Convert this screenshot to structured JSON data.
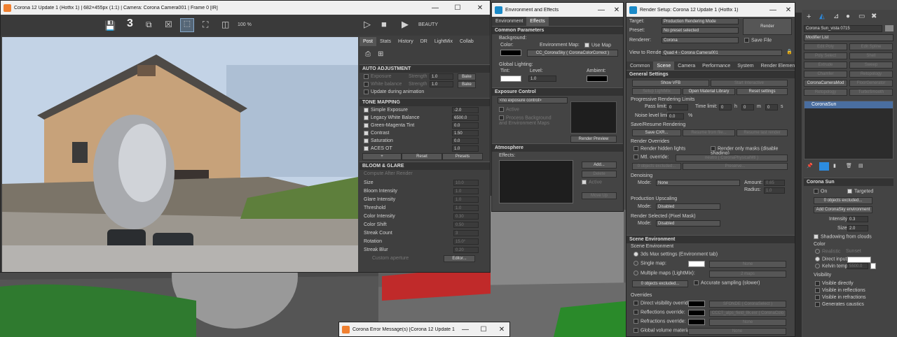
{
  "colors": {
    "accent": "#2c8ce0",
    "viewport_bg": "#3d3d3d",
    "panel": "#444444"
  },
  "vfb": {
    "title": "Corona 12 Update 1 (Hotfix 1) | 682×455px (1:1) | Camera: Corona Camera001 | Frame 0 [IR]",
    "zoom": "100 %",
    "channel": "BEAUTY",
    "tabs": [
      "Post",
      "Stats",
      "History",
      "DR",
      "LightMix",
      "Collab"
    ],
    "auto_adjust": {
      "header": "AUTO ADJUSTMENT",
      "exposure": "Exposure",
      "strength": "Strength",
      "wb": "White balance",
      "val": "1.0",
      "bake": "Bake",
      "update": "Update during animation"
    },
    "tone": {
      "header": "TONE MAPPING",
      "rows": [
        {
          "label": "Simple Exposure",
          "value": "-2.0"
        },
        {
          "label": "Legacy White Balance",
          "value": "6500.0"
        },
        {
          "label": "Green-Magenta Tint",
          "value": "0.0"
        },
        {
          "label": "Contrast",
          "value": "1.50"
        },
        {
          "label": "Saturation",
          "value": "0.0"
        },
        {
          "label": "ACES OT",
          "value": "1.0"
        }
      ],
      "plus": "+",
      "reset": "Reset",
      "presets": "Presets"
    },
    "bloom": {
      "header": "BLOOM & GLARE",
      "compute": "Compute After Render",
      "rows": [
        {
          "label": "Size",
          "value": "10.0"
        },
        {
          "label": "Bloom Intensity",
          "value": "1.0"
        },
        {
          "label": "Glare Intensity",
          "value": "1.0"
        },
        {
          "label": "Threshold",
          "value": "1.0"
        },
        {
          "label": "Color Intensity",
          "value": "0.30"
        },
        {
          "label": "Color Shift",
          "value": "0.50"
        },
        {
          "label": "Streak Count",
          "value": "3"
        },
        {
          "label": "Rotation",
          "value": "15.0°"
        },
        {
          "label": "Streak Blur",
          "value": "0.20"
        }
      ],
      "custom": "Custom aperture",
      "editor": "Editor..."
    }
  },
  "env": {
    "title": "Environment and Effects",
    "tabs": [
      "Environment",
      "Effects"
    ],
    "common": "Common Parameters",
    "background": "Background:",
    "color": "Color:",
    "env_map": "Environment Map:",
    "use_map": "Use Map",
    "map_name": "CC_CoronaSky  ( CoronaColorCorrect )",
    "global": "Global Lighting:",
    "tint": "Tint:",
    "level": "Level:",
    "level_val": "1.0",
    "ambient": "Ambient:",
    "exposure": "Exposure Control",
    "no_exposure": "<no exposure control>",
    "active": "Active",
    "process": "Process Background and Environment Maps",
    "render_preview": "Render Preview",
    "atmos": "Atmosphere",
    "effects": "Effects:",
    "add": "Add...",
    "delete": "Delete",
    "active2": "Active",
    "move_up": "Move Up"
  },
  "rs": {
    "title": "Render Setup: Corona 12 Update 1 (Hotfix 1)",
    "target_l": "Target:",
    "target": "Production Rendering Mode",
    "preset_l": "Preset:",
    "preset": "No preset selected",
    "renderer_l": "Renderer:",
    "renderer": "Corona",
    "save_file": "Save File",
    "render": "Render",
    "view_l": "View to Render:",
    "view": "Quad 4 - Corona Camera001",
    "tabs": [
      "Common",
      "Scene",
      "Camera",
      "Performance",
      "System",
      "Render Elements"
    ],
    "general": "General Settings",
    "show_vfb": "Show VFB",
    "start_int": "Start Interactive",
    "setup_lm": "Setup LightMix",
    "open_lib": "Open Material Library",
    "reset_set": "Reset settings",
    "prog": "Progressive Rendering Limits",
    "pass": "Pass limit:",
    "pass_v": "0",
    "time": "Time limit:",
    "t0": "0",
    "h": "h",
    "m": "m",
    "s": "s",
    "noise": "Noise level limit:",
    "noise_v": "0.0",
    "pct": "%",
    "save_resume": "Save/Resume Rendering",
    "save_cxr": "Save CXR...",
    "resume_file": "Resume from file...",
    "resume_last": "Resume last render",
    "overrides": "Render Overrides",
    "hidden": "Render hidden lights",
    "only_masks": "Render only masks (disable shading)",
    "mtl_over": "Mtl. override:",
    "mtl_val": "neutro  ( CoronaPhysicalMtl )",
    "objs_excl": "0 objects excluded...",
    "preserve": "Preserve...",
    "denoise": "Denoising",
    "mode": "Mode:",
    "none": "None",
    "amount": "Amount:",
    "amount_v": "0.65",
    "radius": "Radius:",
    "radius_v": "1.0",
    "upscale": "Production Upscaling",
    "disabled": "Disabled",
    "pixmask": "Render Selected (Pixel Mask)",
    "scene_env": "Scene Environment",
    "scene_env2": "Scene Environment",
    "max_env": "3ds Max settings (Environment tab)",
    "single_map": "Single map:",
    "multi_map": "Multiple maps (LightMix):",
    "maps2": "2 maps",
    "objs_excl2": "0 objects excluded...",
    "accurate": "Accurate sampling (slower)",
    "ovr": "Overrides",
    "dir_vis": "Direct visibility override:",
    "dir_val": "SFONDE  ( CoronaSelect )",
    "refl": "Reflections override:",
    "refl_val": "CCCT_alps_field_8k.exr  ( CoronaColo",
    "refr": "Refractions override:",
    "refr_val": "None",
    "gvm": "Global volume material:",
    "gvm_val": "None"
  },
  "cmd": {
    "object": "Corona Sun_vista 0715",
    "modlist": "Modifier List",
    "mods": [
      "Edit Poly",
      "Edit Spline",
      "Poly Select",
      "Shell",
      "Extrude",
      "Sweep",
      "Chamfer",
      "Retopology",
      "CoronaCameraMod",
      "FloorGenerator",
      "Retopology",
      "TurboSmooth"
    ],
    "stack_item": "CoronaSun",
    "rollout": "Corona Sun",
    "on": "On",
    "targeted": "Targeted",
    "objs_excl": "0 objects excluded...",
    "add_sky": "Add CoronaSky environment",
    "intensity": "Intensity:",
    "int_v": "0.3",
    "size": "Size:",
    "size_v": "2.0",
    "shadowing": "Shadowing from clouds",
    "color": "Color",
    "realistic": "Realistic",
    "sunset": "Sunset",
    "direct": "Direct input",
    "kelvin": "Kelvin temp",
    "kelvin_v": "5500.0",
    "visibility": "Visibility",
    "vis": [
      "Visible directly",
      "Visible in reflections",
      "Visible in refractions",
      "Generates caustics"
    ]
  },
  "err": {
    "title": "Corona Error Message(s)  [Corona 12 Update 1 ..."
  }
}
